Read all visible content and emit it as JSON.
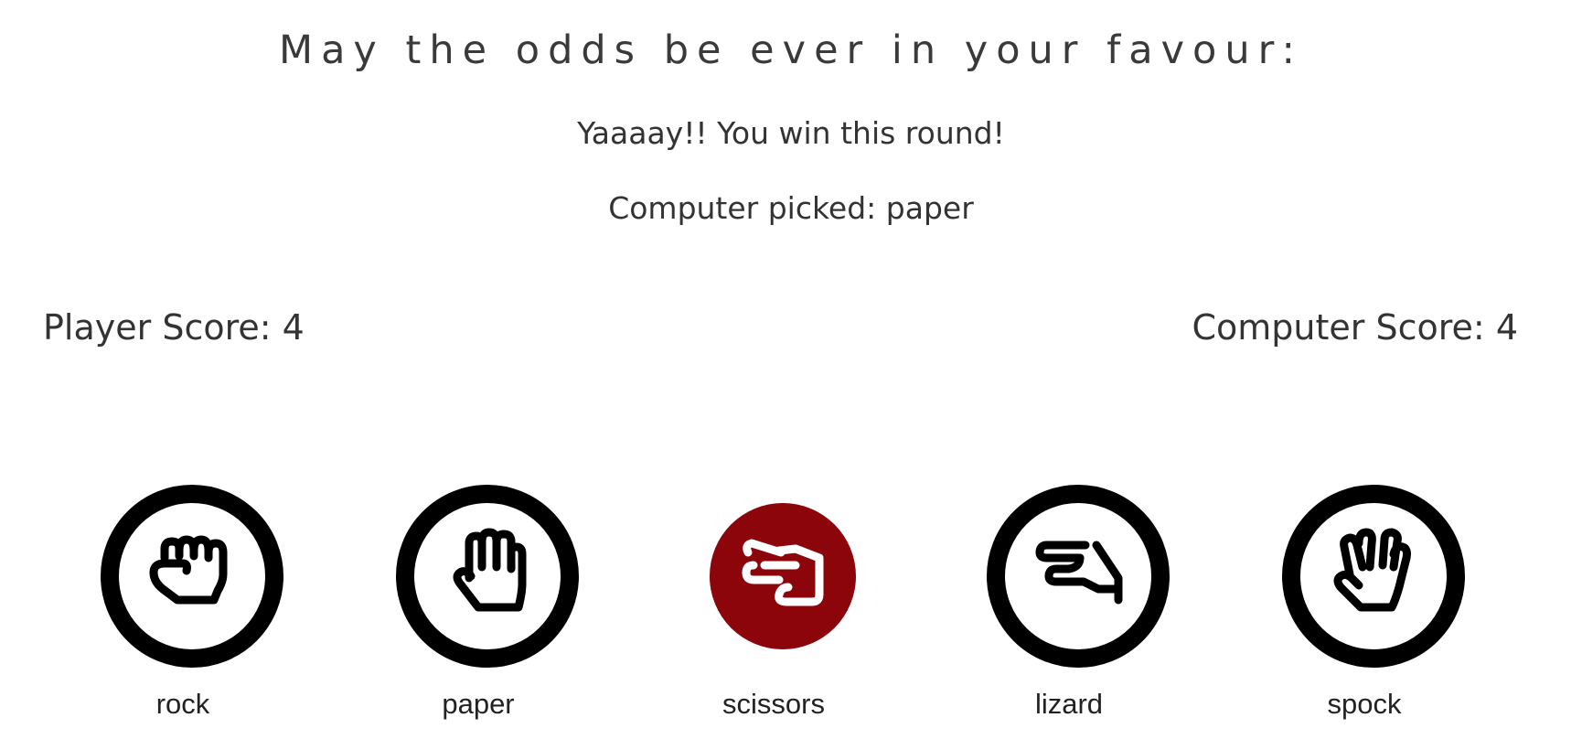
{
  "heading": "May the odds be ever in your favour:",
  "round_result": "Yaaaay!! You win this round!",
  "computer_pick": {
    "label": "Computer picked:",
    "value": "paper"
  },
  "scores": {
    "player_label": "Player Score:",
    "player_value": "4",
    "computer_label": "Computer Score:",
    "computer_value": "4"
  },
  "choices": [
    {
      "label": "rock",
      "icon": "rock-hand-icon",
      "selected": false
    },
    {
      "label": "paper",
      "icon": "paper-hand-icon",
      "selected": false
    },
    {
      "label": "scissors",
      "icon": "scissors-hand-icon",
      "selected": true
    },
    {
      "label": "lizard",
      "icon": "lizard-hand-icon",
      "selected": false
    },
    {
      "label": "spock",
      "icon": "spock-hand-icon",
      "selected": false
    }
  ],
  "colors": {
    "selected_fill": "#8b050b",
    "ring": "#000000",
    "text": "#333333"
  }
}
